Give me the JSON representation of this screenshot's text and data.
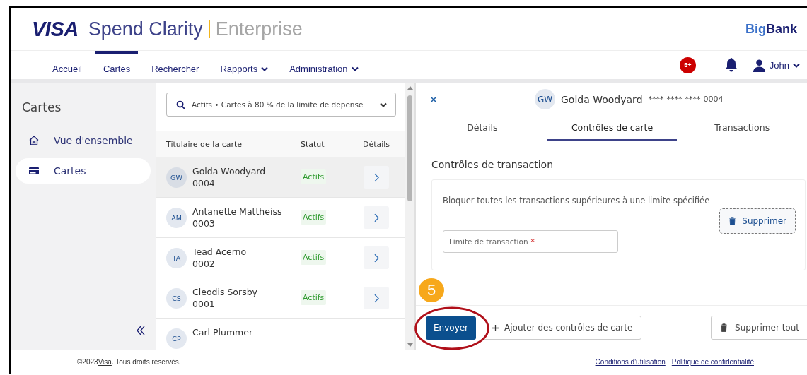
{
  "header": {
    "logo": "VISA",
    "product": "Spend Clarity",
    "edition": "Enterprise",
    "bank_brand": [
      "Big",
      "Bank"
    ]
  },
  "nav": {
    "items": [
      {
        "label": "Accueil",
        "selected": false,
        "dropdown": false
      },
      {
        "label": "Cartes",
        "selected": true,
        "dropdown": false
      },
      {
        "label": "Rechercher",
        "selected": false,
        "dropdown": false
      },
      {
        "label": "Rapports",
        "selected": false,
        "dropdown": true
      },
      {
        "label": "Administration",
        "selected": false,
        "dropdown": true
      }
    ],
    "notification_badge": "5+",
    "user": "John"
  },
  "sidebar": {
    "title": "Cartes",
    "items": [
      {
        "label": "Vue d'ensemble",
        "selected": false
      },
      {
        "label": "Cartes",
        "selected": true
      }
    ]
  },
  "card_list": {
    "filter": "Actifs • Cartes à 80 % de la limite de dépense",
    "columns": [
      "Titulaire de la carte",
      "Statut",
      "Détails"
    ],
    "rows": [
      {
        "initials": "GW",
        "name": "Golda Woodyard",
        "number": "0004",
        "status": "Actifs",
        "selected": true
      },
      {
        "initials": "AM",
        "name": "Antanette Mattheiss",
        "number": "0003",
        "status": "Actifs",
        "selected": false
      },
      {
        "initials": "TA",
        "name": "Tead Acerno",
        "number": "0002",
        "status": "Actifs",
        "selected": false
      },
      {
        "initials": "CS",
        "name": "Cleodis Sorsby",
        "number": "0001",
        "status": "Actifs",
        "selected": false
      },
      {
        "initials": "CP",
        "name": "Carl Plummer",
        "selected": false
      }
    ]
  },
  "detail": {
    "initials": "GW",
    "name": "Golda Woodyard",
    "card_number": "****-****-****-0004",
    "tabs": [
      {
        "label": "Détails",
        "selected": false
      },
      {
        "label": "Contrôles de carte",
        "selected": true
      },
      {
        "label": "Transactions",
        "selected": false
      }
    ],
    "section_title": "Contrôles de transaction",
    "control": {
      "description": "Bloquer toutes les transactions supérieures à une limite spécifiée",
      "remove_button": "Supprimer",
      "field_placeholder": "Limite de transaction",
      "required_mark": "*"
    },
    "buttons": {
      "submit": "Envoyer",
      "add": "Ajouter des contrôles de carte",
      "remove_all": "Supprimer tout"
    }
  },
  "annotation": {
    "step": "5"
  },
  "footer": {
    "copyright_prefix": "©2023",
    "copyright_link": "Visa",
    "copyright_suffix": ". Tous droits réservés.",
    "links": [
      "Conditions d'utilisation",
      "Politique de confidentialité"
    ]
  }
}
